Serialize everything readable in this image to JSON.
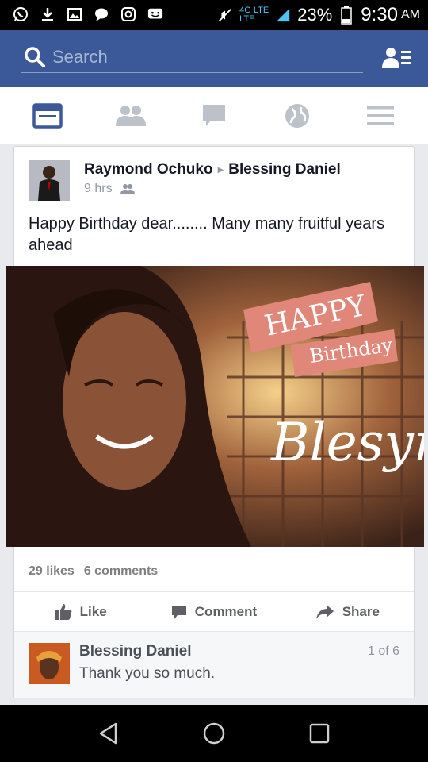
{
  "status_bar": {
    "network_top": "4G LTE",
    "network_bottom": "LTE",
    "battery": "23%",
    "time": "9:30",
    "ampm": "AM"
  },
  "header": {
    "search_placeholder": "Search",
    "icons": [
      "search-icon",
      "friend-requests-icon"
    ]
  },
  "nav_tabs": [
    "news-feed-icon",
    "friends-icon",
    "messages-icon",
    "notifications-globe-icon",
    "menu-icon"
  ],
  "post": {
    "author": "Raymond Ochuko",
    "target": "Blessing Daniel",
    "time": "9 hrs",
    "text": "Happy Birthday dear........ Many many fruitful years ahead",
    "photo_text": {
      "happy": "HAPPY",
      "birthday": "Birthday",
      "name": "Blesyn"
    },
    "likes": "29 likes",
    "comments": "6 comments",
    "actions": {
      "like": "Like",
      "comment": "Comment",
      "share": "Share"
    }
  },
  "comment": {
    "name": "Blessing Daniel",
    "text": "Thank you so much.",
    "count": "1 of 6"
  },
  "colors": {
    "brand": "#3b5998",
    "nav_active": "#3b5998",
    "nav_inactive": "#bdc1c9"
  }
}
